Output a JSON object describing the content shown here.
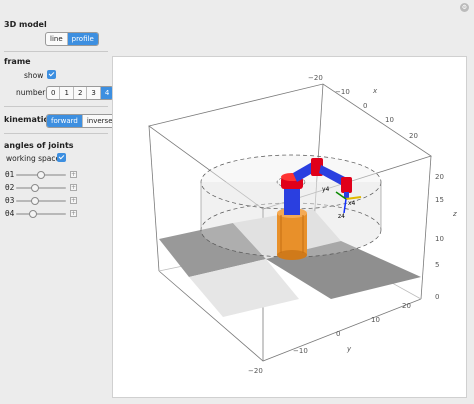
{
  "model": {
    "title": "3D model",
    "options": [
      "line",
      "profile"
    ],
    "selected": "profile"
  },
  "frame": {
    "title": "frame",
    "show_label": "show",
    "show_checked": true,
    "number_label": "number",
    "options": [
      "0",
      "1",
      "2",
      "3",
      "4"
    ],
    "selected": "4"
  },
  "kinematics": {
    "title": "kinematics",
    "options": [
      "forward",
      "inverse"
    ],
    "selected": "forward"
  },
  "joints": {
    "title": "angles of joints",
    "working_space_label": "working space",
    "working_space_checked": true,
    "sliders": [
      {
        "label": "θ1",
        "value": 0.5
      },
      {
        "label": "θ2",
        "value": 0.35
      },
      {
        "label": "θ3",
        "value": 0.35
      },
      {
        "label": "θ4",
        "value": 0.3
      }
    ]
  },
  "plot": {
    "axis_labels": {
      "x": "x",
      "y": "y",
      "z": "z"
    },
    "x_ticks": [
      "−20",
      "−10",
      "0",
      "10",
      "20"
    ],
    "y_ticks": [
      "−20",
      "−10",
      "0",
      "10",
      "20"
    ],
    "z_ticks": [
      "20",
      "15",
      "10",
      "5",
      "0"
    ],
    "frame_labels": [
      "x4",
      "y4",
      "z4"
    ]
  },
  "colors": {
    "accent": "#3d8fe0",
    "link_blue": "#2a3fe0",
    "joint_red": "#e0001a",
    "base_orange": "#e8902a",
    "floor_gray": "#999999"
  }
}
